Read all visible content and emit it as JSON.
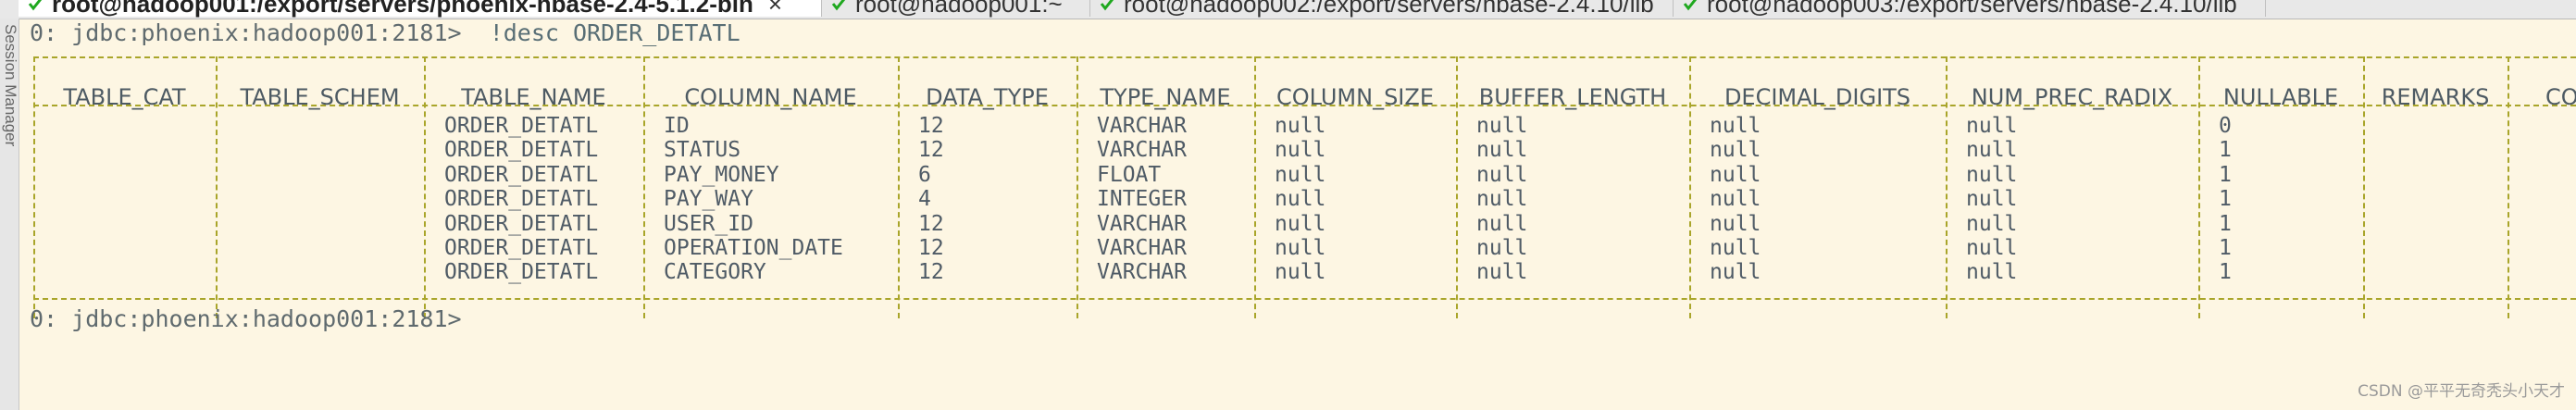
{
  "tabs": [
    {
      "label": "root@hadoop001:/export/servers/phoenix-hbase-2.4-5.1.2-bin",
      "active": true,
      "closable": true
    },
    {
      "label": "root@hadoop001:~",
      "active": false
    },
    {
      "label": "root@hadoop002:/export/servers/hbase-2.4.10/lib",
      "active": false
    },
    {
      "label": "root@hadoop003:/export/servers/hbase-2.4.10/lib",
      "active": false
    }
  ],
  "tab_close_glyph": "×",
  "side_panel": {
    "label": "Session Manager"
  },
  "terminal": {
    "prompt": "0: jdbc:phoenix:hadoop001:2181>",
    "command": "!desc ORDER_DETATL",
    "final_prompt": "0: jdbc:phoenix:hadoop001:2181>"
  },
  "table": {
    "columns": [
      "TABLE_CAT",
      "TABLE_SCHEM",
      "TABLE_NAME",
      "COLUMN_NAME",
      "DATA_TYPE",
      "TYPE_NAME",
      "COLUMN_SIZE",
      "BUFFER_LENGTH",
      "DECIMAL_DIGITS",
      "NUM_PREC_RADIX",
      "NULLABLE",
      "REMARKS",
      "COL"
    ],
    "rows": [
      [
        "",
        "",
        "ORDER_DETATL",
        "ID",
        "12",
        "VARCHAR",
        "null",
        "null",
        "null",
        "null",
        "0",
        "",
        ""
      ],
      [
        "",
        "",
        "ORDER_DETATL",
        "STATUS",
        "12",
        "VARCHAR",
        "null",
        "null",
        "null",
        "null",
        "1",
        "",
        ""
      ],
      [
        "",
        "",
        "ORDER_DETATL",
        "PAY_MONEY",
        "6",
        "FLOAT",
        "null",
        "null",
        "null",
        "null",
        "1",
        "",
        ""
      ],
      [
        "",
        "",
        "ORDER_DETATL",
        "PAY_WAY",
        "4",
        "INTEGER",
        "null",
        "null",
        "null",
        "null",
        "1",
        "",
        ""
      ],
      [
        "",
        "",
        "ORDER_DETATL",
        "USER_ID",
        "12",
        "VARCHAR",
        "null",
        "null",
        "null",
        "null",
        "1",
        "",
        ""
      ],
      [
        "",
        "",
        "ORDER_DETATL",
        "OPERATION_DATE",
        "12",
        "VARCHAR",
        "null",
        "null",
        "null",
        "null",
        "1",
        "",
        ""
      ],
      [
        "",
        "",
        "ORDER_DETATL",
        "CATEGORY",
        "12",
        "VARCHAR",
        "null",
        "null",
        "null",
        "null",
        "1",
        "",
        ""
      ]
    ]
  },
  "watermark": "CSDN @平平无奇秃头小天才",
  "colors": {
    "background": "#fdf6e3",
    "border": "#a9a52a",
    "text": "#4f5b66",
    "tab_ok": "#1fa81f"
  },
  "icons": {
    "tab_status": "green-check-icon"
  }
}
